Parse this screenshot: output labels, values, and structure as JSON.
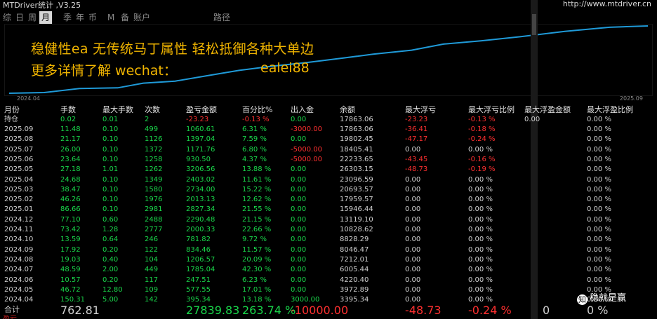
{
  "window": {
    "title": "MTDriver统计 ,V3.25",
    "site": "http://www.mtdriver.cn"
  },
  "tabs": [
    "综",
    "日",
    "周",
    "月",
    "季",
    "年",
    "币",
    "M",
    "备",
    "账户"
  ],
  "active_tab": "月",
  "path_label": "路径",
  "chart": {
    "x_start": "2024.04",
    "x_end": "2025.09",
    "line_color": "#1f9ad8",
    "points": [
      [
        0.0,
        0.0
      ],
      [
        0.055,
        0.01
      ],
      [
        0.11,
        0.07
      ],
      [
        0.17,
        0.08
      ],
      [
        0.21,
        0.15
      ],
      [
        0.26,
        0.18
      ],
      [
        0.31,
        0.26
      ],
      [
        0.36,
        0.34
      ],
      [
        0.41,
        0.4
      ],
      [
        0.47,
        0.46
      ],
      [
        0.52,
        0.52
      ],
      [
        0.57,
        0.58
      ],
      [
        0.63,
        0.64
      ],
      [
        0.68,
        0.73
      ],
      [
        0.74,
        0.78
      ],
      [
        0.8,
        0.84
      ],
      [
        0.87,
        0.92
      ],
      [
        0.94,
        0.98
      ],
      [
        1.0,
        1.0
      ]
    ]
  },
  "overlay": {
    "line1": "稳健性ea  无传统马丁属性 轻松抵御各种大单边",
    "line2": "更多详情了解 wechat：",
    "wechat_id": "ealei88",
    "color": "#f0b400"
  },
  "table": {
    "headers": [
      "月份",
      "手数",
      "最大手数",
      "次数",
      "盈亏金额",
      "百分比%",
      "出入金",
      "余额",
      "最大浮亏",
      "最大浮亏比例",
      "最大浮盈金额",
      "最大浮盈比例"
    ],
    "holding": {
      "label": "持仓",
      "cells": [
        "0.02",
        "0.01",
        "2",
        "-23.23",
        "-0.13 %",
        "0.00",
        "17863.06",
        "-23.23",
        "-0.13 %",
        "0.00",
        "0.00 %"
      ]
    },
    "rows": [
      [
        "2025.09",
        "11.48",
        "0.10",
        "499",
        "1060.61",
        "6.31 %",
        "-3000.00",
        "17863.06",
        "-36.41",
        "-0.18 %",
        "",
        "0.00 %"
      ],
      [
        "2025.08",
        "21.17",
        "0.10",
        "1126",
        "1397.04",
        "7.59 %",
        "0.00",
        "19802.45",
        "-47.17",
        "-0.24 %",
        "",
        "0.00 %"
      ],
      [
        "2025.07",
        "26.00",
        "0.10",
        "1372",
        "1171.76",
        "6.80 %",
        "-5000.00",
        "18405.41",
        "0.00",
        "0.00 %",
        "",
        "0.00 %"
      ],
      [
        "2025.06",
        "23.64",
        "0.10",
        "1258",
        "930.50",
        "4.37 %",
        "-5000.00",
        "22233.65",
        "-43.45",
        "-0.16 %",
        "",
        "0.00 %"
      ],
      [
        "2025.05",
        "27.18",
        "1.01",
        "1262",
        "3206.56",
        "13.88 %",
        "0.00",
        "26303.15",
        "-48.73",
        "-0.19 %",
        "",
        "0.00 %"
      ],
      [
        "2025.04",
        "24.68",
        "0.10",
        "1349",
        "2403.02",
        "11.61 %",
        "0.00",
        "23096.59",
        "0.00",
        "0.00 %",
        "",
        "0.00 %"
      ],
      [
        "2025.03",
        "38.47",
        "0.10",
        "1580",
        "2734.00",
        "15.22 %",
        "0.00",
        "20693.57",
        "0.00",
        "0.00 %",
        "",
        "0.00 %"
      ],
      [
        "2025.02",
        "46.26",
        "0.10",
        "1976",
        "2013.13",
        "12.62 %",
        "0.00",
        "17959.57",
        "0.00",
        "0.00 %",
        "",
        "0.00 %"
      ],
      [
        "2025.01",
        "86.66",
        "0.10",
        "2981",
        "2827.34",
        "21.55 %",
        "0.00",
        "15946.44",
        "0.00",
        "0.00 %",
        "",
        "0.00 %"
      ],
      [
        "2024.12",
        "77.10",
        "0.60",
        "2488",
        "2290.48",
        "21.15 %",
        "0.00",
        "13119.10",
        "0.00",
        "0.00 %",
        "",
        "0.00 %"
      ],
      [
        "2024.11",
        "73.42",
        "1.28",
        "2777",
        "2000.33",
        "22.66 %",
        "0.00",
        "10828.62",
        "0.00",
        "0.00 %",
        "",
        "0.00 %"
      ],
      [
        "2024.10",
        "13.59",
        "0.64",
        "246",
        "781.82",
        "9.72 %",
        "0.00",
        "8828.29",
        "0.00",
        "0.00 %",
        "",
        "0.00 %"
      ],
      [
        "2024.09",
        "17.92",
        "0.20",
        "122",
        "834.46",
        "11.57 %",
        "0.00",
        "8046.47",
        "0.00",
        "0.00 %",
        "",
        "0.00 %"
      ],
      [
        "2024.08",
        "19.03",
        "0.40",
        "104",
        "1206.57",
        "20.09 %",
        "0.00",
        "7212.01",
        "0.00",
        "0.00 %",
        "",
        "0.00 %"
      ],
      [
        "2024.07",
        "48.59",
        "2.00",
        "449",
        "1785.04",
        "42.30 %",
        "0.00",
        "6005.44",
        "0.00",
        "0.00 %",
        "",
        "0.00 %"
      ],
      [
        "2024.06",
        "10.57",
        "0.20",
        "117",
        "247.51",
        "6.23 %",
        "0.00",
        "4220.40",
        "0.00",
        "0.00 %",
        "",
        "0.00 %"
      ],
      [
        "2024.05",
        "46.72",
        "12.80",
        "109",
        "577.55",
        "17.01 %",
        "0.00",
        "3972.89",
        "0.00",
        "0.00 %",
        "",
        "0.00 %"
      ],
      [
        "2024.04",
        "150.31",
        "5.00",
        "142",
        "395.34",
        "13.18 %",
        "3000.00",
        "3395.34",
        "0.00",
        "0.00 %",
        "",
        "0.00 %"
      ]
    ],
    "total": {
      "label": "合计",
      "lots": "762.81",
      "pnl": "27839.83",
      "pct": "263.74 %",
      "flow": "-10000.00",
      "max_dd": "-48.73",
      "max_dd_pct": "-0.24 %",
      "max_float_gain": "0",
      "max_float_gain_pct": "0 %"
    }
  },
  "watermark": {
    "text": "稳就是赢"
  },
  "footer_label": "盈亏"
}
